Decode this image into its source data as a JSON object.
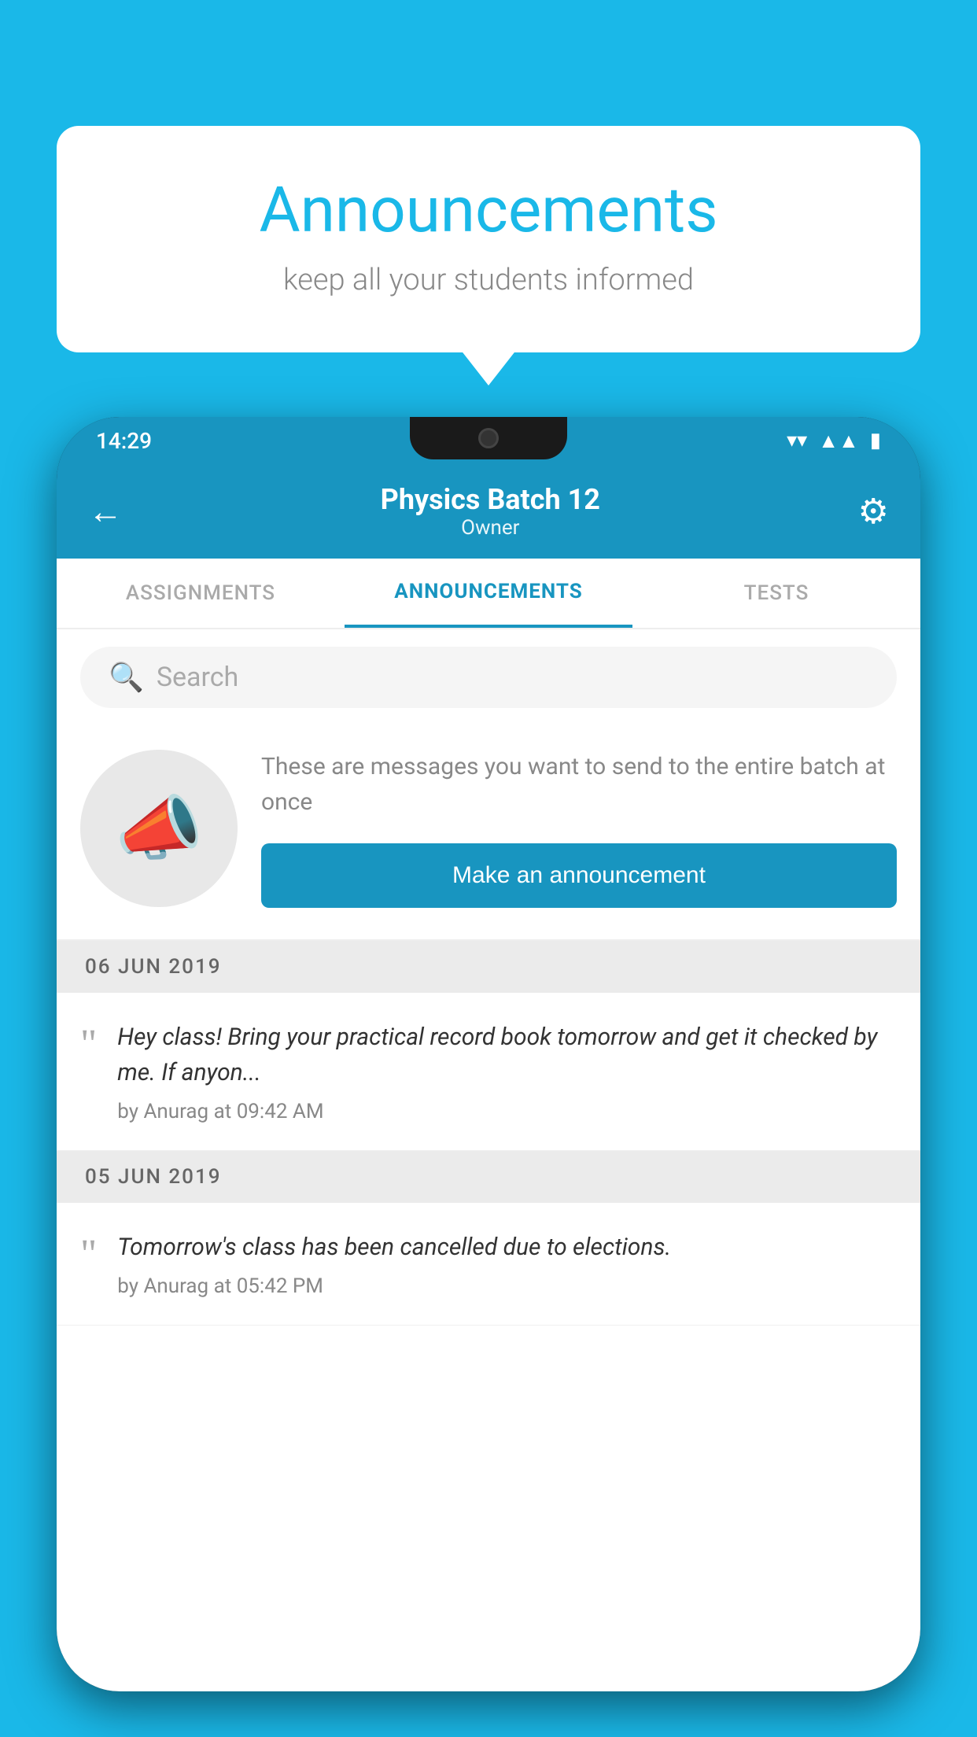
{
  "background": {
    "color": "#1ab8e8"
  },
  "speech_bubble": {
    "title": "Announcements",
    "subtitle": "keep all your students informed"
  },
  "phone": {
    "status_bar": {
      "time": "14:29",
      "icons": [
        "wifi",
        "signal",
        "battery"
      ]
    },
    "app_bar": {
      "title": "Physics Batch 12",
      "subtitle": "Owner",
      "back_label": "←",
      "settings_label": "⚙"
    },
    "tabs": [
      {
        "label": "ASSIGNMENTS",
        "active": false
      },
      {
        "label": "ANNOUNCEMENTS",
        "active": true
      },
      {
        "label": "TESTS",
        "active": false
      }
    ],
    "search": {
      "placeholder": "Search"
    },
    "announcement_prompt": {
      "description": "These are messages you want to send to the entire batch at once",
      "button_label": "Make an announcement"
    },
    "announcements": [
      {
        "date": "06  JUN  2019",
        "items": [
          {
            "text": "Hey class! Bring your practical record book tomorrow and get it checked by me. If anyon...",
            "meta": "by Anurag at 09:42 AM"
          }
        ]
      },
      {
        "date": "05  JUN  2019",
        "items": [
          {
            "text": "Tomorrow's class has been cancelled due to elections.",
            "meta": "by Anurag at 05:42 PM"
          }
        ]
      }
    ]
  }
}
